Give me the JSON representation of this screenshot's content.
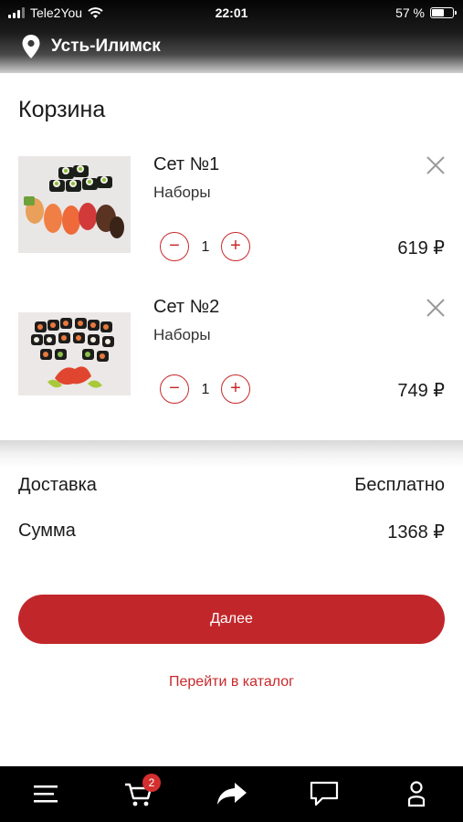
{
  "status_bar": {
    "carrier": "Tele2You",
    "time": "22:01",
    "battery": "57 %",
    "battery_level": 0.57
  },
  "header": {
    "location": "Усть-Илимск",
    "location_icon": "map-pin-icon"
  },
  "page": {
    "title": "Корзина"
  },
  "cart": {
    "items": [
      {
        "name": "Сет №1",
        "category": "Наборы",
        "quantity": "1",
        "price": "619 ₽",
        "image": "sushi-set-photo"
      },
      {
        "name": "Сет №2",
        "category": "Наборы",
        "quantity": "1",
        "price": "749 ₽",
        "image": "sushi-set-photo"
      }
    ],
    "minus_glyph": "−",
    "plus_glyph": "+"
  },
  "summary": {
    "delivery_label": "Доставка",
    "delivery_value": "Бесплатно",
    "total_label": "Сумма",
    "total_value": "1368 ₽"
  },
  "actions": {
    "next_label": "Далее",
    "catalog_link": "Перейти в каталог"
  },
  "bottom_nav": {
    "cart_badge": "2",
    "icons": [
      "menu-icon",
      "cart-icon",
      "share-icon",
      "chat-icon",
      "profile-icon"
    ]
  },
  "colors": {
    "accent": "#c1272a",
    "nav_background": "#000000"
  }
}
